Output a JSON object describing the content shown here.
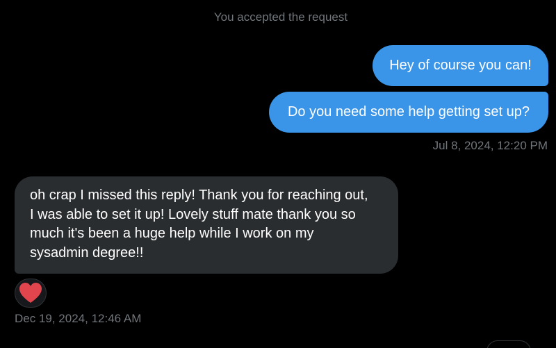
{
  "conversation": {
    "system_note": "You accepted the request",
    "outgoing": [
      {
        "text": "Hey of course you can!"
      },
      {
        "text": "Do you need some help getting set up?"
      }
    ],
    "outgoing_timestamp": "Jul 8, 2024, 12:20 PM",
    "incoming": {
      "lines": [
        "oh crap I missed this reply! Thank you for reaching out,",
        "I was able to set it up! Lovely stuff mate thank you so",
        "much it's been a huge help while I work on my",
        "sysadmin degree!!"
      ],
      "reaction_icon": "heart-icon",
      "timestamp": "Dec 19, 2024, 12:46 AM"
    }
  },
  "colors": {
    "background": "#000000",
    "outgoing_bubble": "#3a94e8",
    "incoming_bubble": "#2a2d30",
    "muted_text": "#71767b",
    "heart": "#e0454d"
  }
}
